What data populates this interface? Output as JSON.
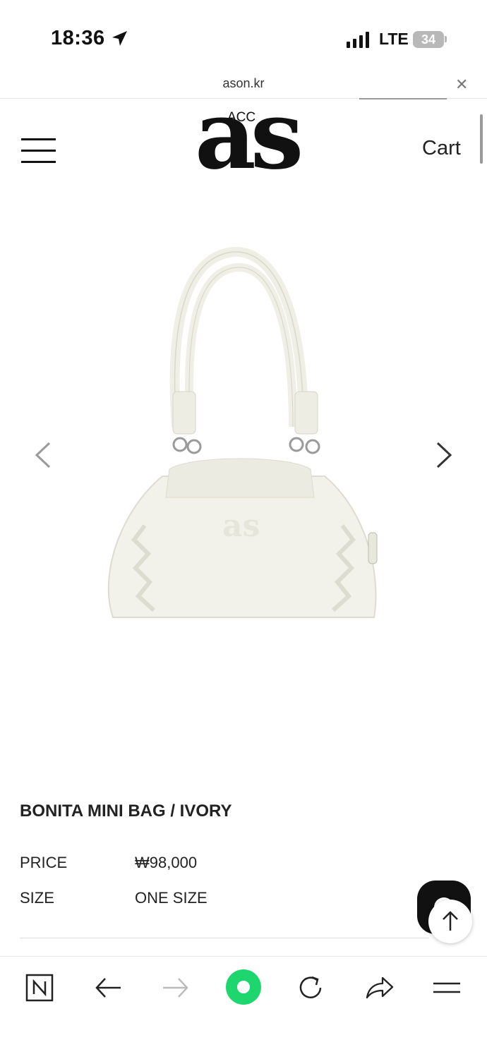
{
  "status_bar": {
    "time": "18:36",
    "network": "LTE",
    "battery": "34"
  },
  "browser": {
    "url": "ason.kr",
    "close_icon": "close-icon"
  },
  "header": {
    "logo_sub": "ACC",
    "logo_main": "as",
    "cart_label": "Cart",
    "menu_icon": "hamburger-menu-icon"
  },
  "gallery": {
    "image": "ivory-mini-shoulder-bag-photo",
    "prev_icon": "chevron-left-icon",
    "next_icon": "chevron-right-icon"
  },
  "product": {
    "title": "BONITA MINI BAG / IVORY",
    "price_label": "PRICE",
    "price_value": "₩98,000",
    "size_label": "SIZE",
    "size_value": "ONE SIZE"
  },
  "floating": {
    "chat_icon": "chat-icon",
    "top_icon": "arrow-up-icon"
  },
  "toolbar": {
    "items": [
      "naver-home-icon",
      "back-arrow-icon",
      "forward-arrow-icon",
      "green-dot-icon",
      "reload-icon",
      "share-icon",
      "menu-lines-icon"
    ]
  },
  "colors": {
    "text": "#222222",
    "accent_green": "#1ed66e",
    "divider": "#dddddd"
  }
}
